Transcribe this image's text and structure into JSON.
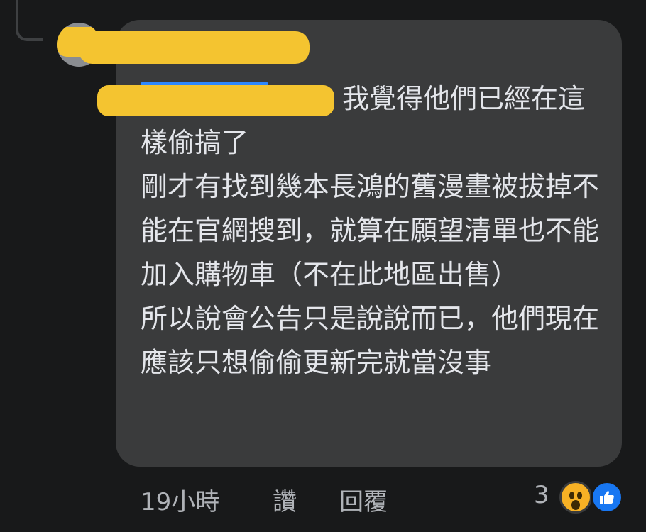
{
  "comment": {
    "author": "",
    "lines": [
      "我覺得他們已經在這樣偷搞了",
      "剛才有找到幾本長鴻的舊漫畫被拔掉不能在官網搜到，就算在願望清單也不能加入購物車（不在此地區出售）",
      "所以說會公告只是說說而已，他們現在應該只想偷偷更新完就當沒事"
    ]
  },
  "meta": {
    "time": "19小時",
    "like_label": "讚",
    "reply_label": "回覆"
  },
  "reactions": {
    "count": "3",
    "icons": [
      "wow-icon",
      "like-icon"
    ],
    "colors": {
      "wow": "#f7b125",
      "like": "#1877f2"
    }
  },
  "colors": {
    "background": "#18191a",
    "bubble": "#3a3b3c",
    "text": "#e4e6eb",
    "secondary_text": "#b0b3b8",
    "redaction": "#f4c430"
  }
}
